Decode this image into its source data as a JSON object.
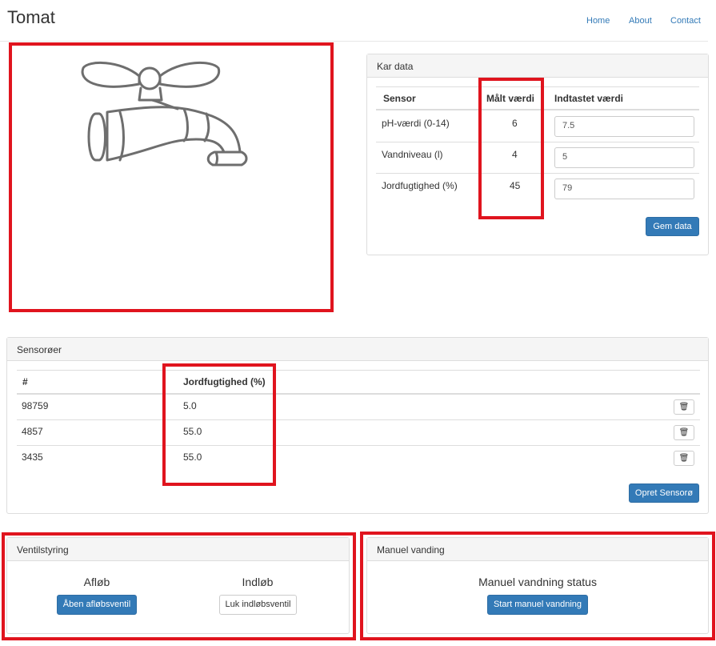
{
  "app": {
    "brand": "Tomat"
  },
  "nav": {
    "items": [
      "Home",
      "About",
      "Contact"
    ]
  },
  "kar": {
    "title": "Kar data",
    "headers": [
      "Sensor",
      "Målt værdi",
      "Indtastet værdi"
    ],
    "rows": [
      {
        "sensor": "pH-værdi (0-14)",
        "measured": "6",
        "input": "7.5"
      },
      {
        "sensor": "Vandniveau (l)",
        "measured": "4",
        "input": "5"
      },
      {
        "sensor": "Jordfugtighed (%)",
        "measured": "45",
        "input": "79"
      }
    ],
    "save_label": "Gem data"
  },
  "sensors": {
    "title": "Sensorøer",
    "headers": [
      "#",
      "Jordfugtighed (%)"
    ],
    "rows": [
      {
        "id": "98759",
        "value": "5.0"
      },
      {
        "id": "4857",
        "value": "55.0"
      },
      {
        "id": "3435",
        "value": "55.0"
      }
    ],
    "create_label": "Opret Sensorø"
  },
  "valve": {
    "title": "Ventilstyring",
    "outlet_label": "Afløb",
    "outlet_button": "Åben afløbsventil",
    "inlet_label": "Indløb",
    "inlet_button": "Luk indløbsventil"
  },
  "manual": {
    "title": "Manuel vanding",
    "status_label": "Manuel vandning status",
    "start_button": "Start manuel vandning"
  },
  "colors": {
    "accent": "#337ab7",
    "highlight": "#e0141e"
  },
  "icons": {
    "delete": "trash-icon",
    "faucet": "faucet-illustration"
  }
}
